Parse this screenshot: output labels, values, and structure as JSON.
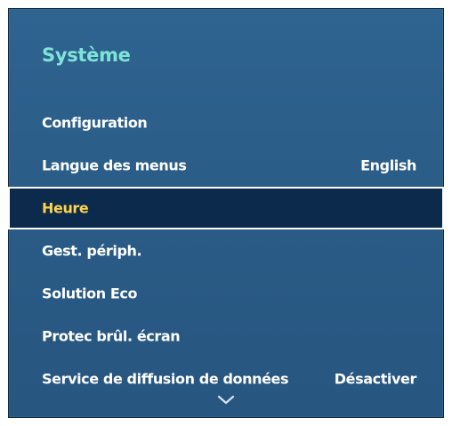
{
  "menu": {
    "title": "Système",
    "items": [
      {
        "label": "Configuration",
        "value": ""
      },
      {
        "label": "Langue des menus",
        "value": "English"
      },
      {
        "label": "Heure",
        "value": ""
      },
      {
        "label": "Gest. périph.",
        "value": ""
      },
      {
        "label": "Solution Eco",
        "value": ""
      },
      {
        "label": "Protec brûl. écran",
        "value": ""
      },
      {
        "label": "Service de diffusion de données",
        "value": "Désactiver"
      }
    ],
    "selected_index": 2,
    "more_indicator_icon": "chevron-down-icon"
  },
  "colors": {
    "panel_background": "#2a5c87",
    "title": "#7fe4d8",
    "item_text": "#ffffff",
    "selected_background": "#0b2a4c",
    "selected_text": "#ffd24a",
    "selected_border": "#ffffff"
  }
}
